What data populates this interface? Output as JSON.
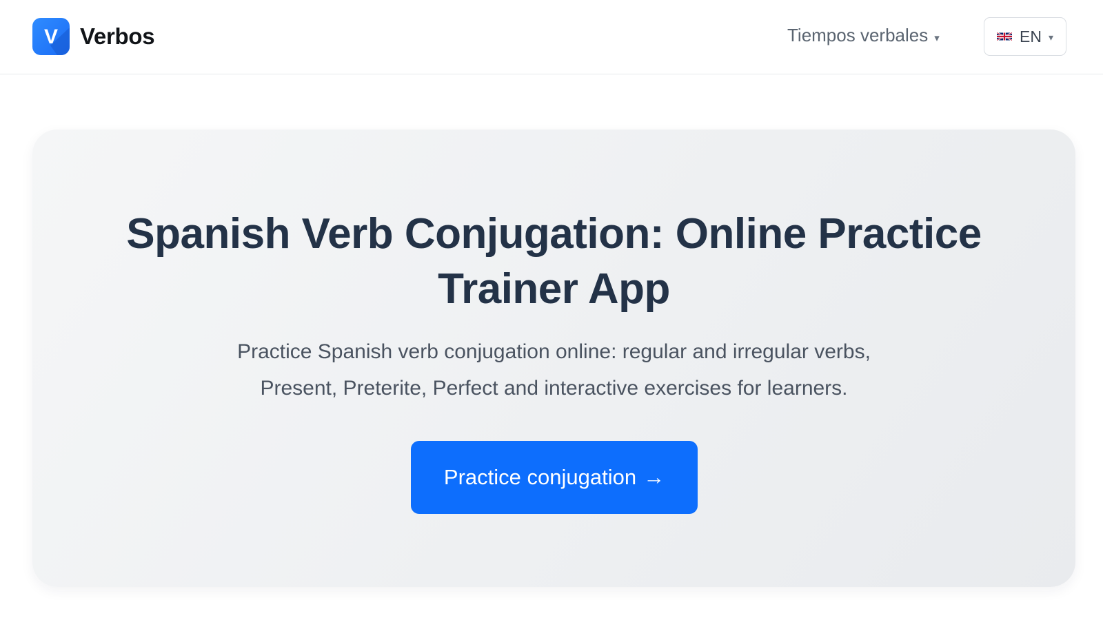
{
  "header": {
    "brand_letter": "V",
    "brand_name": "Verbos",
    "brand_color": "#1b6cf5",
    "nav_tenses_label": "Tiempos verbales",
    "nav_tenses_caret": "▾",
    "language": {
      "code": "EN",
      "flag_icon": "uk-flag-icon",
      "caret": "▾"
    }
  },
  "hero": {
    "title": "Spanish Verb Conjugation: Online Practice Trainer App",
    "subtitle": "Practice Spanish verb conjugation online: regular and irregular verbs, Present, Preterite, Perfect and interactive exercises for learners.",
    "cta_label": "Practice conjugation",
    "cta_arrow": "→",
    "cta_color": "#0d6efd"
  }
}
